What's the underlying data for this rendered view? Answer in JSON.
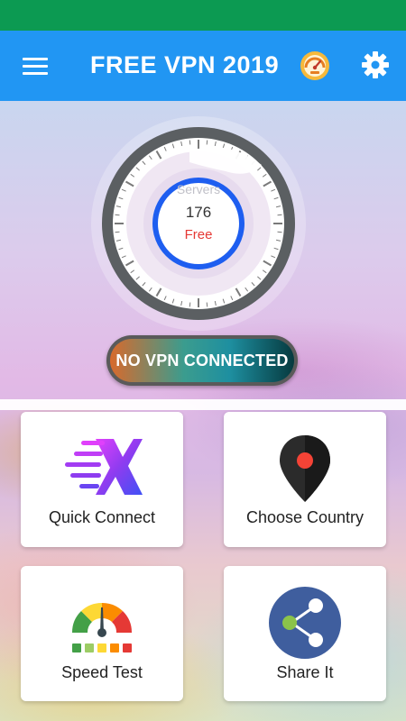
{
  "app_bar": {
    "title": "FREE VPN 2019",
    "menu_icon": "hamburger-menu-icon",
    "speed_icon": "speedometer-icon",
    "settings_icon": "gear-icon",
    "color": "#2196f3"
  },
  "status_bar": {
    "color": "#0c9a52"
  },
  "dial": {
    "servers_label": "Servers",
    "server_count": "176",
    "tier_label": "Free",
    "ring_color": "#1e5ef0"
  },
  "connection": {
    "status_text": "NO VPN CONNECTED"
  },
  "actions": [
    {
      "label": "Quick Connect",
      "icon": "quick-connect-x-icon"
    },
    {
      "label": "Choose Country",
      "icon": "location-pin-icon"
    },
    {
      "label": "Speed Test",
      "icon": "speed-gauge-icon"
    },
    {
      "label": "Share It",
      "icon": "share-icon"
    }
  ]
}
